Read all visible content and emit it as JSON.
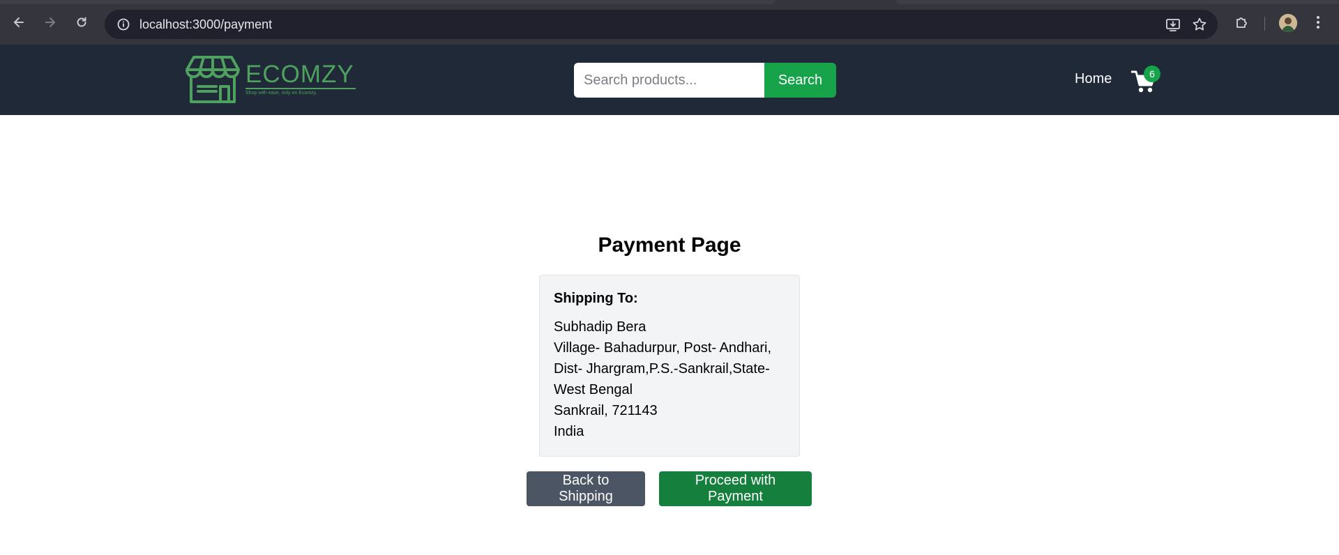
{
  "browser": {
    "url": "localhost:3000/payment"
  },
  "header": {
    "logo_text": "ECOMZY",
    "logo_tagline": "Shop with ease, only on Ecomzy.",
    "search_placeholder": "Search products...",
    "search_button": "Search",
    "home_link": "Home",
    "cart_count": "6"
  },
  "main": {
    "title": "Payment Page",
    "shipping": {
      "label": "Shipping To:",
      "name": "Subhadip Bera",
      "address_lines": [
        "Village- Bahadurpur, Post- Andhari,",
        "Dist- Jhargram,P.S.-Sankrail,State-",
        "West Bengal"
      ],
      "city_zip": "Sankrail, 721143",
      "country": "India"
    },
    "back_button": "Back to Shipping",
    "proceed_button": "Proceed with Payment"
  },
  "colors": {
    "header_bg": "#1f2937",
    "brand_green": "#4fa15f",
    "primary_green": "#16a34a",
    "proceed_green": "#15803d",
    "back_gray": "#4b5563",
    "card_bg": "#f3f4f6"
  },
  "icons": {
    "back": "arrow-left-icon",
    "forward": "arrow-right-icon",
    "reload": "reload-icon",
    "site_info": "info-icon",
    "install": "install-app-icon",
    "bookmark": "star-icon",
    "extensions": "puzzle-icon",
    "menu": "kebab-menu-icon",
    "cart": "shopping-cart-icon"
  }
}
